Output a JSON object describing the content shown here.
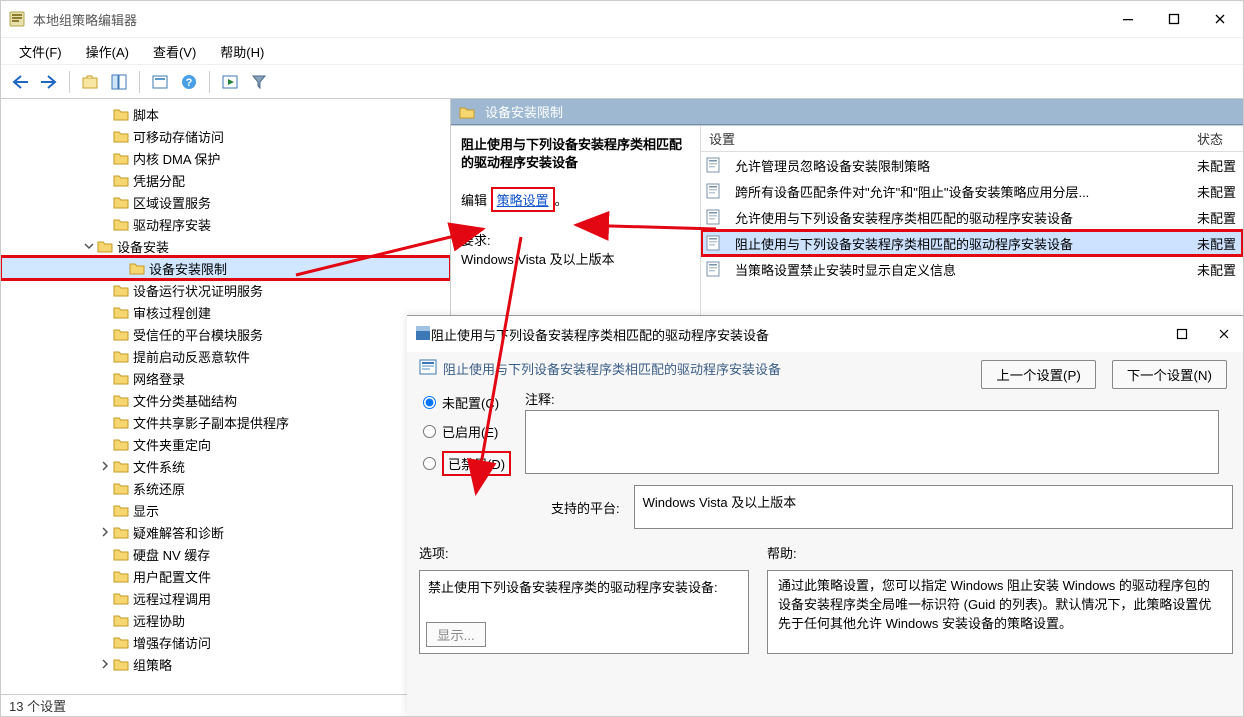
{
  "window": {
    "title": "本地组策略编辑器",
    "menus": [
      "文件(F)",
      "操作(A)",
      "查看(V)",
      "帮助(H)"
    ]
  },
  "tree": [
    {
      "indent": 96,
      "label": "脚本"
    },
    {
      "indent": 96,
      "label": "可移动存储访问"
    },
    {
      "indent": 96,
      "label": "内核 DMA 保护"
    },
    {
      "indent": 96,
      "label": "凭据分配"
    },
    {
      "indent": 96,
      "label": "区域设置服务"
    },
    {
      "indent": 96,
      "label": "驱动程序安装"
    },
    {
      "indent": 80,
      "label": "设备安装",
      "caret": "v"
    },
    {
      "indent": 112,
      "label": "设备安装限制",
      "selected": true,
      "redbox": true
    },
    {
      "indent": 96,
      "label": "设备运行状况证明服务"
    },
    {
      "indent": 96,
      "label": "审核过程创建"
    },
    {
      "indent": 96,
      "label": "受信任的平台模块服务"
    },
    {
      "indent": 96,
      "label": "提前启动反恶意软件"
    },
    {
      "indent": 96,
      "label": "网络登录"
    },
    {
      "indent": 96,
      "label": "文件分类基础结构"
    },
    {
      "indent": 96,
      "label": "文件共享影子副本提供程序"
    },
    {
      "indent": 96,
      "label": "文件夹重定向"
    },
    {
      "indent": 96,
      "label": "文件系统",
      "caret": ">"
    },
    {
      "indent": 96,
      "label": "系统还原"
    },
    {
      "indent": 96,
      "label": "显示"
    },
    {
      "indent": 96,
      "label": "疑难解答和诊断",
      "caret": ">"
    },
    {
      "indent": 96,
      "label": "硬盘 NV 缓存"
    },
    {
      "indent": 96,
      "label": "用户配置文件"
    },
    {
      "indent": 96,
      "label": "远程过程调用"
    },
    {
      "indent": 96,
      "label": "远程协助"
    },
    {
      "indent": 96,
      "label": "增强存储访问"
    },
    {
      "indent": 96,
      "label": "组策略",
      "caret": ">"
    }
  ],
  "statusbar": "13 个设置",
  "right": {
    "category_title": "设备安装限制",
    "desc_title": "阻止使用与下列设备安装程序类相匹配的驱动程序安装设备",
    "edit_label": "编辑",
    "policy_link": "策略设置",
    "req_label": "要求:",
    "req_value": "Windows Vista 及以上版本",
    "cols": {
      "setting": "设置",
      "state": "状态"
    },
    "rows": [
      {
        "label": "允许管理员忽略设备安装限制策略",
        "state": "未配置"
      },
      {
        "label": "跨所有设备匹配条件对\"允许\"和\"阻止\"设备安装策略应用分层...",
        "state": "未配置"
      },
      {
        "label": "允许使用与下列设备安装程序类相匹配的驱动程序安装设备",
        "state": "未配置"
      },
      {
        "label": "阻止使用与下列设备安装程序类相匹配的驱动程序安装设备",
        "state": "未配置",
        "selected": true,
        "redbox": true
      },
      {
        "label": "当策略设置禁止安装时显示自定义信息",
        "state": "未配置"
      }
    ]
  },
  "dialog": {
    "title": "阻止使用与下列设备安装程序类相匹配的驱动程序安装设备",
    "prev_btn": "上一个设置(P)",
    "next_btn": "下一个设置(N)",
    "radio_notconf": "未配置(C)",
    "radio_enabled": "已启用(E)",
    "radio_disabled": "已禁用(D)",
    "comment_label": "注释:",
    "platform_label": "支持的平台:",
    "platform_value": "Windows Vista 及以上版本",
    "options_label": "选项:",
    "option_text": "禁止使用下列设备安装程序类的驱动程序安装设备:",
    "show_btn": "显示...",
    "help_label": "帮助:",
    "help_text": "通过此策略设置，您可以指定 Windows 阻止安装 Windows 的驱动程序包的设备安装程序类全局唯一标识符 (Guid 的列表)。默认情况下，此策略设置优先于任何其他允许 Windows 安装设备的策略设置。"
  }
}
